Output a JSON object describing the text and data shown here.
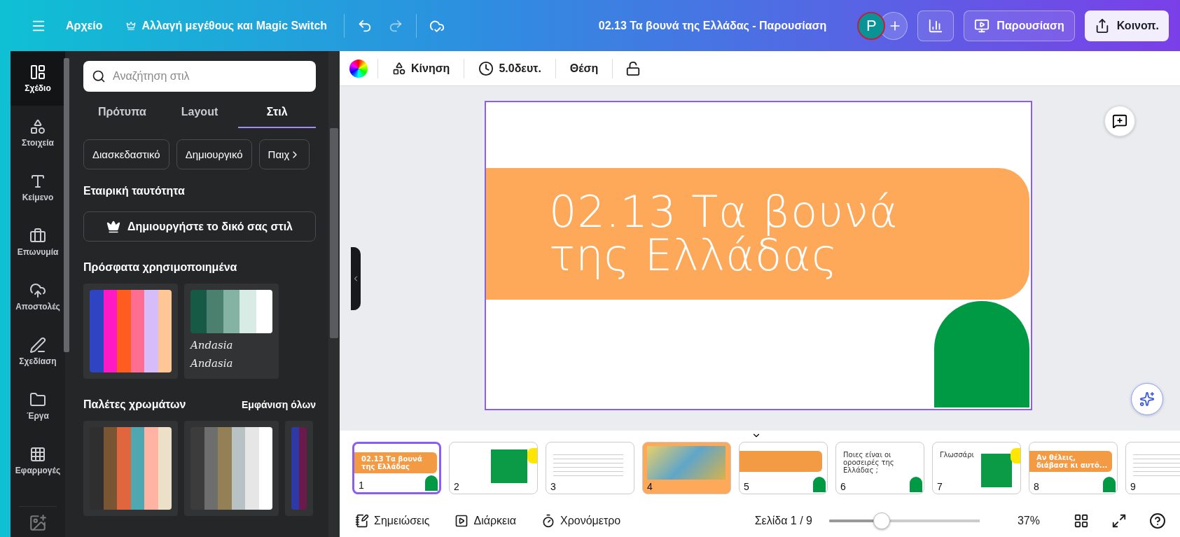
{
  "topbar": {
    "file_menu": "Αρχείο",
    "resize": "Αλλαγή μεγέθους και Magic Switch",
    "doc_title": "02.13 Τα βουνά της Ελλάδας - Παρουσίαση",
    "avatar": "P",
    "present": "Παρουσίαση",
    "share": "Κοινοπ."
  },
  "rail": [
    {
      "label": "Σχέδιο",
      "selected": true
    },
    {
      "label": "Στοιχεία",
      "selected": false
    },
    {
      "label": "Κείμενο",
      "selected": false
    },
    {
      "label": "Επωνυμία",
      "selected": false
    },
    {
      "label": "Αποστολές",
      "selected": false
    },
    {
      "label": "Σχεδίαση",
      "selected": false
    },
    {
      "label": "Έργα",
      "selected": false
    },
    {
      "label": "Εφαρμογές",
      "selected": false
    }
  ],
  "panel": {
    "search": {
      "placeholder": "Αναζήτηση στιλ"
    },
    "tabs": [
      {
        "label": "Πρότυπα",
        "selected": false
      },
      {
        "label": "Layout",
        "selected": false
      },
      {
        "label": "Στιλ",
        "selected": true
      }
    ],
    "chips": [
      "Διασκεδαστικό",
      "Δημιουργικό",
      "Παιχ"
    ],
    "brand_heading": "Εταιρική ταυτότητα",
    "create_style": "Δημιουργήστε το δικό σας στιλ",
    "recent_heading": "Πρόσφατα χρησιμοποιημένα",
    "recent": [
      {
        "swatches": [
          {
            "color": "#2e44c2"
          },
          {
            "color": "#ff1ac6"
          },
          {
            "color": "#ff5c1f"
          },
          {
            "color": "#ff6e91"
          },
          {
            "color": "#d6bdfa"
          },
          {
            "color": "#ffc796"
          }
        ]
      },
      {
        "swatches": [
          {
            "color": "#165a45"
          },
          {
            "color": "#4c806e"
          },
          {
            "color": "#84b3a3"
          },
          {
            "color": "#d9ebe5"
          },
          {
            "color": "#ffffff"
          }
        ],
        "font_samples": [
          "Andasia",
          "Andasia"
        ]
      }
    ],
    "palettes_heading": "Παλέτες χρωμάτων",
    "see_all": "Εμφάνιση όλων",
    "palettes": [
      {
        "swatches": [
          {
            "color": "#2f2f2f"
          },
          {
            "color": "#7a5534"
          },
          {
            "color": "#e0673d"
          },
          {
            "color": "#4fa8b0"
          },
          {
            "color": "#ffb3a3"
          },
          {
            "color": "#ede0c8"
          }
        ]
      },
      {
        "swatches": [
          {
            "color": "#3c3c3c"
          },
          {
            "color": "#6e6e6e"
          },
          {
            "color": "#948056"
          },
          {
            "color": "#b8c2c4"
          },
          {
            "color": "#e6e6e6"
          },
          {
            "color": "#ffffff"
          }
        ]
      },
      {
        "swatches": [
          {
            "color": "#2d3aa6"
          },
          {
            "color": "#6a1a4a"
          }
        ]
      }
    ]
  },
  "toolbar": {
    "animate": "Κίνηση",
    "duration": "5.0δευτ.",
    "position": "Θέση"
  },
  "slide": {
    "title_lines": [
      "02.13 Τα βουνά",
      "της Ελλάδας"
    ]
  },
  "thumbnails": [
    {
      "number": "1",
      "selected": true,
      "kind": "title",
      "title": "02.13 Τα βουνά της Ελλάδας"
    },
    {
      "number": "2",
      "selected": false,
      "kind": "photo"
    },
    {
      "number": "3",
      "selected": false,
      "kind": "text"
    },
    {
      "number": "4",
      "selected": false,
      "kind": "map"
    },
    {
      "number": "5",
      "selected": false,
      "kind": "band"
    },
    {
      "number": "6",
      "selected": false,
      "kind": "question",
      "title": "Ποιες είναι οι οροσειρές της Ελλάδας ;"
    },
    {
      "number": "7",
      "selected": false,
      "kind": "glossary",
      "title": "Γλωσσάρι"
    },
    {
      "number": "8",
      "selected": false,
      "kind": "title",
      "title": "Αν θέλεις, διάβασε κι αυτό..."
    },
    {
      "number": "9",
      "selected": false,
      "kind": "text"
    }
  ],
  "bottombar": {
    "notes": "Σημειώσεις",
    "duration": "Διάρκεια",
    "timer": "Χρονόμετρο",
    "page": "Σελίδα 1 / 9",
    "zoom": {
      "level": 0.35
    },
    "zoom_reading": "37%"
  }
}
